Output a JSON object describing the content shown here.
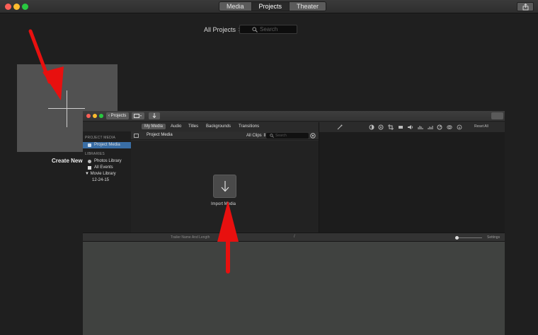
{
  "outer": {
    "tabs": [
      {
        "label": "Media",
        "active": false
      },
      {
        "label": "Projects",
        "active": true
      },
      {
        "label": "Theater",
        "active": false
      }
    ],
    "filter_label": "All Projects ⇕",
    "search_placeholder": "Search",
    "create_new_label": "Create New"
  },
  "inner": {
    "projects_button": "‹ Projects",
    "media_tabs": [
      {
        "label": "My Media",
        "active": true
      },
      {
        "label": "Audio",
        "active": false
      },
      {
        "label": "Titles",
        "active": false
      },
      {
        "label": "Backgrounds",
        "active": false
      },
      {
        "label": "Transitions",
        "active": false
      }
    ],
    "sidebar": {
      "project_header": "PROJECT MEDIA",
      "project_item": "Project Media",
      "libraries_header": "LIBRARIES",
      "libraries": [
        {
          "label": "Photos Library",
          "icon": "photos-icon"
        },
        {
          "label": "All Events",
          "icon": "star-icon"
        },
        {
          "label": "▼ Movie Library",
          "icon": "none"
        },
        {
          "label": "12-24-15",
          "icon": "none"
        }
      ]
    },
    "browser": {
      "title": "Project Media",
      "clips_filter": "All Clips ⇕",
      "search_placeholder": "Search",
      "import_label": "Import Media"
    },
    "viewer": {
      "reset_label": "Reset All"
    },
    "timeline": {
      "trailer_label": "Trailer Name And Length",
      "slash": "/",
      "settings_label": "Settings"
    }
  },
  "colors": {
    "accent_selected": "#3a6ea5",
    "arrow": "#e8100f",
    "traffic_red": "#fc5f57",
    "traffic_yellow": "#fdbc2e",
    "traffic_green": "#28c840"
  }
}
